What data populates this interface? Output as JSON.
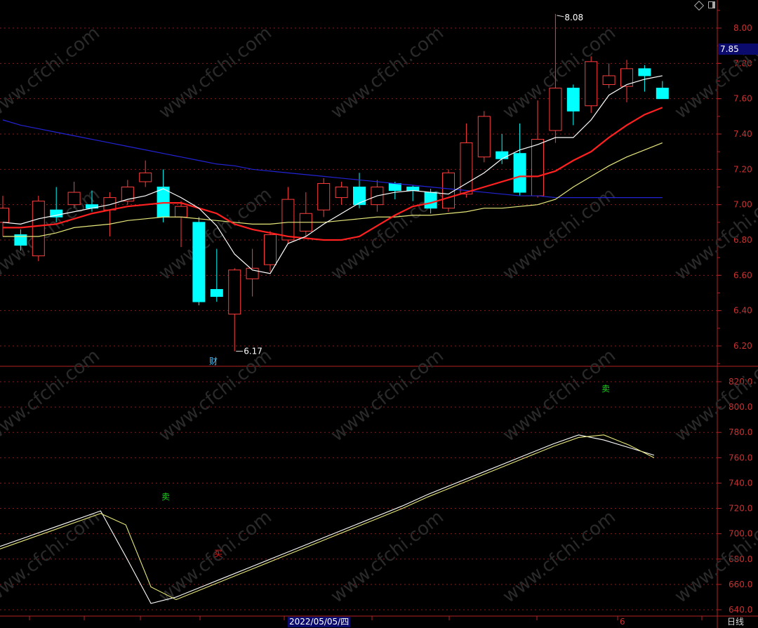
{
  "current_price": "7.85",
  "timeframe_label": "日线",
  "date_label": "2022/05/05/四",
  "date_label_short": "6",
  "colors": {
    "up": "#ff3c3c",
    "down": "#00ffff",
    "ma5": "#ffffff",
    "ma10": "#ff2020",
    "ma20": "#e8e87a",
    "ma60": "#2323d6",
    "grid": "#8b1a1a",
    "axis": "#b22222"
  },
  "chart_data": [
    {
      "type": "candlestick",
      "ylim": [
        6.1,
        8.2
      ],
      "y_ticks": [
        "8.00",
        "7.80",
        "7.60",
        "7.40",
        "7.20",
        "7.00",
        "6.80",
        "6.60",
        "6.40",
        "6.20"
      ],
      "candles": [
        {
          "o": 6.9,
          "c": 6.98,
          "h": 7.05,
          "l": 6.82
        },
        {
          "o": 6.83,
          "c": 6.77,
          "h": 6.86,
          "l": 6.74
        },
        {
          "o": 6.71,
          "c": 7.02,
          "h": 7.05,
          "l": 6.68
        },
        {
          "o": 6.97,
          "c": 6.93,
          "h": 7.1,
          "l": 6.9
        },
        {
          "o": 7.0,
          "c": 7.07,
          "h": 7.13,
          "l": 6.98
        },
        {
          "o": 7.0,
          "c": 6.98,
          "h": 7.08,
          "l": 6.96
        },
        {
          "o": 6.97,
          "c": 7.04,
          "h": 7.07,
          "l": 6.82
        },
        {
          "o": 7.02,
          "c": 7.1,
          "h": 7.14,
          "l": 7.0
        },
        {
          "o": 7.13,
          "c": 7.18,
          "h": 7.25,
          "l": 7.1
        },
        {
          "o": 7.1,
          "c": 6.93,
          "h": 7.2,
          "l": 6.9
        },
        {
          "o": 6.93,
          "c": 6.99,
          "h": 7.02,
          "l": 6.76
        },
        {
          "o": 6.9,
          "c": 6.45,
          "h": 6.93,
          "l": 6.43
        },
        {
          "o": 6.52,
          "c": 6.48,
          "h": 6.75,
          "l": 6.45
        },
        {
          "o": 6.38,
          "c": 6.63,
          "h": 6.64,
          "l": 6.17
        },
        {
          "o": 6.58,
          "c": 6.64,
          "h": 6.75,
          "l": 6.48
        },
        {
          "o": 6.66,
          "c": 6.83,
          "h": 6.85,
          "l": 6.62
        },
        {
          "o": 6.8,
          "c": 7.03,
          "h": 7.1,
          "l": 6.78
        },
        {
          "o": 6.85,
          "c": 6.95,
          "h": 7.07,
          "l": 6.82
        },
        {
          "o": 6.97,
          "c": 7.12,
          "h": 7.15,
          "l": 6.93
        },
        {
          "o": 7.04,
          "c": 7.1,
          "h": 7.13,
          "l": 7.0
        },
        {
          "o": 7.1,
          "c": 7.0,
          "h": 7.18,
          "l": 6.98
        },
        {
          "o": 7.0,
          "c": 7.1,
          "h": 7.14,
          "l": 6.96
        },
        {
          "o": 7.12,
          "c": 7.08,
          "h": 7.13,
          "l": 7.03
        },
        {
          "o": 7.1,
          "c": 7.08,
          "h": 7.11,
          "l": 7.02
        },
        {
          "o": 7.07,
          "c": 6.98,
          "h": 7.09,
          "l": 6.95
        },
        {
          "o": 6.98,
          "c": 7.18,
          "h": 7.2,
          "l": 6.96
        },
        {
          "o": 7.06,
          "c": 7.35,
          "h": 7.46,
          "l": 7.04
        },
        {
          "o": 7.27,
          "c": 7.5,
          "h": 7.53,
          "l": 7.24
        },
        {
          "o": 7.3,
          "c": 7.26,
          "h": 7.4,
          "l": 7.23
        },
        {
          "o": 7.29,
          "c": 7.07,
          "h": 7.46,
          "l": 7.05
        },
        {
          "o": 7.05,
          "c": 7.37,
          "h": 7.59,
          "l": 7.04
        },
        {
          "o": 7.42,
          "c": 7.66,
          "h": 8.08,
          "l": 7.35
        },
        {
          "o": 7.66,
          "c": 7.53,
          "h": 7.68,
          "l": 7.45
        },
        {
          "o": 7.56,
          "c": 7.81,
          "h": 7.84,
          "l": 7.52
        },
        {
          "o": 7.68,
          "c": 7.73,
          "h": 7.8,
          "l": 7.66
        },
        {
          "o": 7.67,
          "c": 7.77,
          "h": 7.82,
          "l": 7.58
        },
        {
          "o": 7.77,
          "c": 7.73,
          "h": 7.79,
          "l": 7.64
        },
        {
          "o": 7.66,
          "c": 7.6,
          "h": 7.7,
          "l": 7.6
        }
      ],
      "ma5": [
        6.9,
        6.89,
        6.92,
        6.94,
        6.96,
        6.98,
        7.0,
        7.03,
        7.05,
        7.09,
        7.04,
        6.98,
        6.88,
        6.72,
        6.63,
        6.61,
        6.78,
        6.82,
        6.89,
        6.95,
        7.01,
        7.05,
        7.07,
        7.08,
        7.07,
        7.06,
        7.12,
        7.18,
        7.26,
        7.31,
        7.34,
        7.38,
        7.38,
        7.48,
        7.62,
        7.68,
        7.71,
        7.73
      ],
      "ma10": [
        6.87,
        6.87,
        6.88,
        6.89,
        6.92,
        6.95,
        6.97,
        6.99,
        7.0,
        7.01,
        7.01,
        6.98,
        6.95,
        6.89,
        6.86,
        6.84,
        6.82,
        6.81,
        6.8,
        6.8,
        6.82,
        6.88,
        6.94,
        6.99,
        7.01,
        7.04,
        7.07,
        7.1,
        7.13,
        7.16,
        7.16,
        7.19,
        7.25,
        7.3,
        7.38,
        7.45,
        7.51,
        7.55
      ],
      "ma20": [
        6.82,
        6.82,
        6.82,
        6.84,
        6.87,
        6.88,
        6.89,
        6.91,
        6.92,
        6.93,
        6.93,
        6.92,
        6.91,
        6.9,
        6.89,
        6.89,
        6.9,
        6.9,
        6.9,
        6.91,
        6.92,
        6.93,
        6.93,
        6.94,
        6.94,
        6.95,
        6.96,
        6.98,
        6.98,
        6.99,
        7.0,
        7.03,
        7.1,
        7.16,
        7.22,
        7.27,
        7.31,
        7.35
      ],
      "ma60": [
        7.48,
        7.45,
        7.43,
        7.41,
        7.39,
        7.37,
        7.35,
        7.33,
        7.31,
        7.29,
        7.27,
        7.25,
        7.23,
        7.22,
        7.2,
        7.19,
        7.18,
        7.17,
        7.16,
        7.15,
        7.14,
        7.13,
        7.12,
        7.11,
        7.1,
        7.09,
        7.08,
        7.07,
        7.06,
        7.05,
        7.05,
        7.04,
        7.04,
        7.04,
        7.04,
        7.04,
        7.04,
        7.04
      ],
      "annotations": [
        {
          "label": "8.08",
          "type": "high"
        },
        {
          "label": "6.17",
          "type": "low"
        }
      ],
      "event_marker": "财"
    },
    {
      "type": "line",
      "ylim": [
        630,
        830
      ],
      "y_ticks": [
        "820.0",
        "800.0",
        "780.0",
        "760.0",
        "740.0",
        "720.0",
        "700.0",
        "680.0",
        "660.0",
        "640.0"
      ],
      "series": [
        {
          "color": "#ffffff",
          "values": [
            690,
            697,
            704,
            711,
            718,
            682,
            645,
            650,
            658,
            666,
            674,
            682,
            690,
            698,
            706,
            714,
            722,
            731,
            739,
            747,
            755,
            763,
            771,
            778,
            774,
            768,
            762
          ]
        },
        {
          "color": "#e8e87a",
          "values": [
            688,
            695,
            702,
            709,
            716,
            707,
            658,
            648,
            656,
            664,
            672,
            680,
            688,
            696,
            704,
            712,
            720,
            729,
            737,
            745,
            753,
            761,
            769,
            776,
            778,
            770,
            760
          ]
        }
      ],
      "signals": [
        {
          "text": "卖",
          "color": "#1ed21e"
        },
        {
          "text": "买",
          "color": "#e61e1e"
        },
        {
          "text": "卖",
          "color": "#1ed21e"
        }
      ]
    }
  ]
}
